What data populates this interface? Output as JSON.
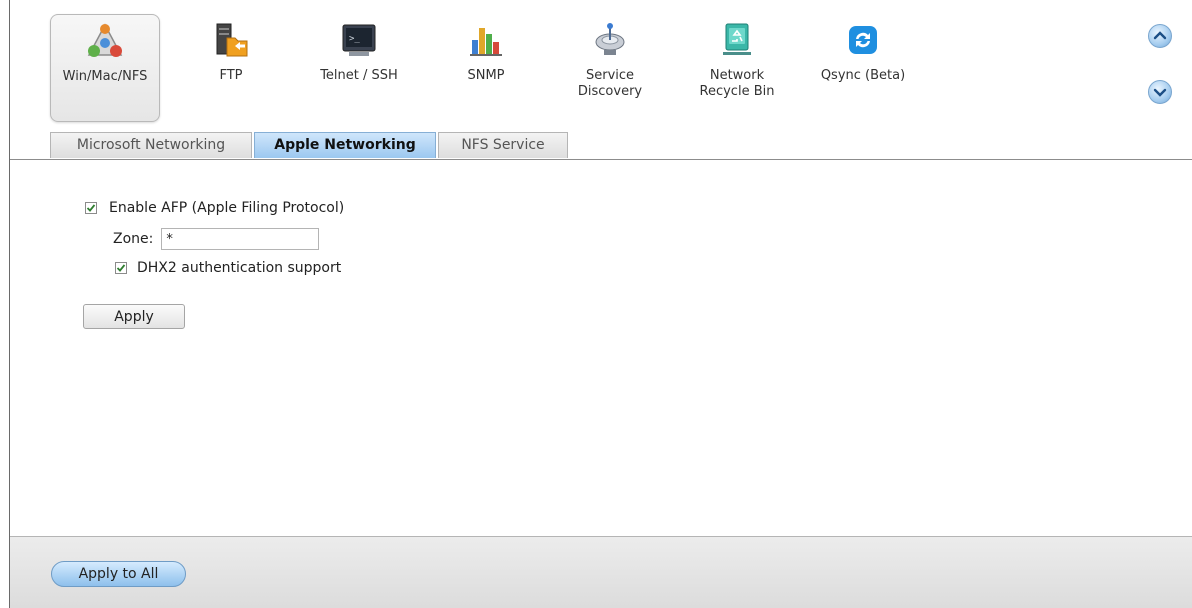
{
  "toolbar": {
    "items": [
      {
        "label": "Win/Mac/NFS",
        "icon": "network-file-sharing-icon"
      },
      {
        "label": "FTP",
        "icon": "ftp-folder-icon"
      },
      {
        "label": "Telnet / SSH",
        "icon": "terminal-icon"
      },
      {
        "label": "SNMP",
        "icon": "bar-chart-icon"
      },
      {
        "label": "Service Discovery",
        "icon": "satellite-dish-icon"
      },
      {
        "label": "Network Recycle Bin",
        "icon": "recycle-bin-icon"
      },
      {
        "label": "Qsync (Beta)",
        "icon": "sync-icon"
      }
    ],
    "scroll_up_icon": "chevron-up-icon",
    "scroll_down_icon": "chevron-down-icon"
  },
  "tabs": [
    {
      "label": "Microsoft Networking"
    },
    {
      "label": "Apple Networking"
    },
    {
      "label": "NFS Service"
    }
  ],
  "form": {
    "enable_afp_label": "Enable AFP (Apple Filing Protocol)",
    "enable_afp_checked": true,
    "zone_label": "Zone:",
    "zone_value": "*",
    "dhx2_label": "DHX2 authentication support",
    "dhx2_checked": true,
    "apply_label": "Apply"
  },
  "footer": {
    "apply_all_label": "Apply to All"
  },
  "colors": {
    "active_tab": "#9cc8f0",
    "apply_all_button": "#8ec0ec",
    "checkmark": "#2f7d2f"
  }
}
